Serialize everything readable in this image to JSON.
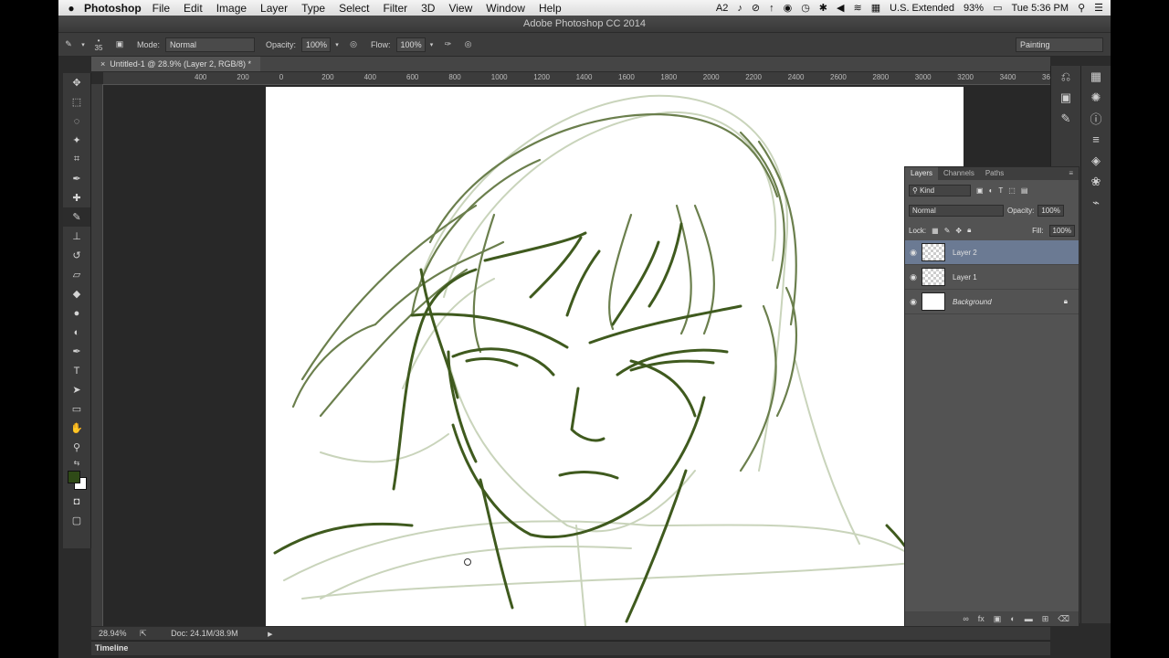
{
  "menubar": {
    "app_name": "Photoshop",
    "items": [
      "File",
      "Edit",
      "Image",
      "Layer",
      "Type",
      "Select",
      "Filter",
      "3D",
      "View",
      "Window",
      "Help"
    ],
    "status": {
      "adobe_count": "2",
      "input_source": "U.S. Extended",
      "battery": "93%",
      "clock": "Tue 5:36 PM"
    }
  },
  "window": {
    "title": "Adobe Photoshop CC 2014"
  },
  "options_bar": {
    "brush_size": "35",
    "mode_label": "Mode:",
    "mode_value": "Normal",
    "opacity_label": "Opacity:",
    "opacity_value": "100%",
    "flow_label": "Flow:",
    "flow_value": "100%",
    "workspace": "Painting"
  },
  "document": {
    "tab_title": "Untitled-1 @ 28.9% (Layer 2, RGB/8) *"
  },
  "ruler": {
    "top_labels": [
      "400",
      "200",
      "0",
      "200",
      "400",
      "600",
      "800",
      "1000",
      "1200",
      "1400",
      "1600",
      "1800",
      "2000",
      "2200",
      "2400",
      "2600",
      "2800",
      "3000",
      "3200",
      "3400",
      "3600",
      "38"
    ]
  },
  "status_bar": {
    "zoom": "28.94%",
    "doc": "Doc: 24.1M/38.9M"
  },
  "timeline": {
    "label": "Timeline"
  },
  "layers_panel": {
    "tabs": [
      "Layers",
      "Channels",
      "Paths"
    ],
    "filter": "Kind",
    "blend_mode": "Normal",
    "opacity_label": "Opacity:",
    "opacity_value": "100%",
    "lock_label": "Lock:",
    "fill_label": "Fill:",
    "fill_value": "100%",
    "layers": [
      {
        "name": "Layer 2",
        "selected": true
      },
      {
        "name": "Layer 1",
        "selected": false
      },
      {
        "name": "Background",
        "selected": false,
        "locked": true
      }
    ]
  },
  "colors": {
    "foreground": "#2f4a17",
    "sketch": "#3f5a1e",
    "selection": "#6b7a93"
  }
}
